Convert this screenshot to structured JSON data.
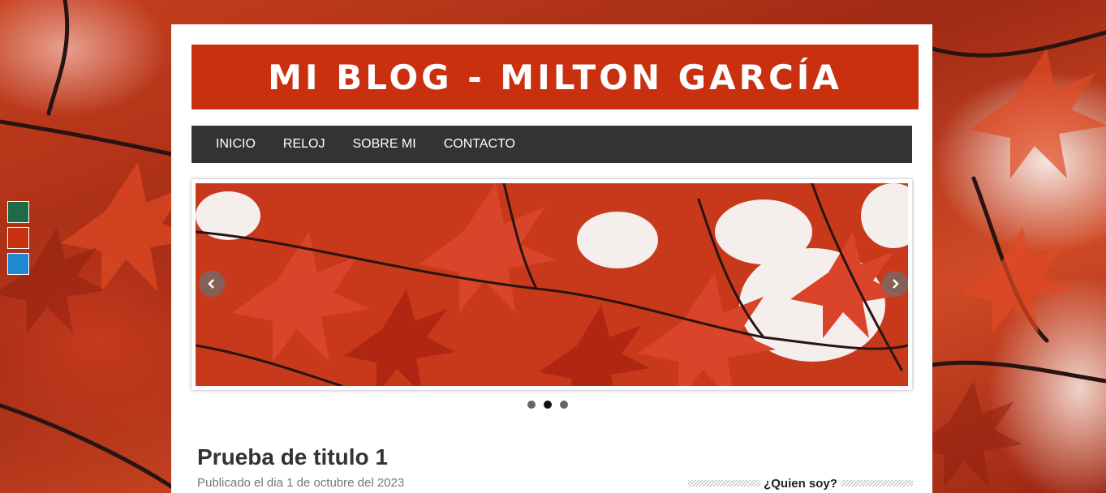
{
  "header": {
    "title": "MI BLOG - MILTON GARCÍA"
  },
  "nav": {
    "items": [
      "INICIO",
      "RELOJ",
      "SOBRE MI",
      "CONTACTO"
    ]
  },
  "theme_swatches": [
    {
      "name": "green",
      "color": "#1f6b45"
    },
    {
      "name": "red",
      "color": "#c9300f"
    },
    {
      "name": "blue",
      "color": "#1f88cf"
    }
  ],
  "slider": {
    "slide_count": 3,
    "active_slide": 2,
    "prev_icon": "chevron-left-icon",
    "next_icon": "chevron-right-icon"
  },
  "post": {
    "title": "Prueba de titulo 1",
    "meta": "Publicado el dia 1 de octubre del 2023"
  },
  "sidebar": {
    "widget_title": "¿Quien soy?"
  },
  "colors": {
    "accent": "#c9300f",
    "nav_bg": "#333333"
  }
}
